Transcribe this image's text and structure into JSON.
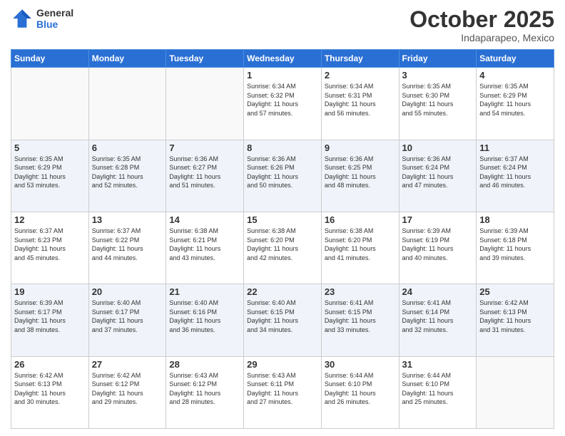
{
  "header": {
    "logo_general": "General",
    "logo_blue": "Blue",
    "month_title": "October 2025",
    "location": "Indaparapeo, Mexico"
  },
  "weekdays": [
    "Sunday",
    "Monday",
    "Tuesday",
    "Wednesday",
    "Thursday",
    "Friday",
    "Saturday"
  ],
  "weeks": [
    [
      {
        "day": "",
        "info": ""
      },
      {
        "day": "",
        "info": ""
      },
      {
        "day": "",
        "info": ""
      },
      {
        "day": "1",
        "info": "Sunrise: 6:34 AM\nSunset: 6:32 PM\nDaylight: 11 hours\nand 57 minutes."
      },
      {
        "day": "2",
        "info": "Sunrise: 6:34 AM\nSunset: 6:31 PM\nDaylight: 11 hours\nand 56 minutes."
      },
      {
        "day": "3",
        "info": "Sunrise: 6:35 AM\nSunset: 6:30 PM\nDaylight: 11 hours\nand 55 minutes."
      },
      {
        "day": "4",
        "info": "Sunrise: 6:35 AM\nSunset: 6:29 PM\nDaylight: 11 hours\nand 54 minutes."
      }
    ],
    [
      {
        "day": "5",
        "info": "Sunrise: 6:35 AM\nSunset: 6:29 PM\nDaylight: 11 hours\nand 53 minutes."
      },
      {
        "day": "6",
        "info": "Sunrise: 6:35 AM\nSunset: 6:28 PM\nDaylight: 11 hours\nand 52 minutes."
      },
      {
        "day": "7",
        "info": "Sunrise: 6:36 AM\nSunset: 6:27 PM\nDaylight: 11 hours\nand 51 minutes."
      },
      {
        "day": "8",
        "info": "Sunrise: 6:36 AM\nSunset: 6:26 PM\nDaylight: 11 hours\nand 50 minutes."
      },
      {
        "day": "9",
        "info": "Sunrise: 6:36 AM\nSunset: 6:25 PM\nDaylight: 11 hours\nand 48 minutes."
      },
      {
        "day": "10",
        "info": "Sunrise: 6:36 AM\nSunset: 6:24 PM\nDaylight: 11 hours\nand 47 minutes."
      },
      {
        "day": "11",
        "info": "Sunrise: 6:37 AM\nSunset: 6:24 PM\nDaylight: 11 hours\nand 46 minutes."
      }
    ],
    [
      {
        "day": "12",
        "info": "Sunrise: 6:37 AM\nSunset: 6:23 PM\nDaylight: 11 hours\nand 45 minutes."
      },
      {
        "day": "13",
        "info": "Sunrise: 6:37 AM\nSunset: 6:22 PM\nDaylight: 11 hours\nand 44 minutes."
      },
      {
        "day": "14",
        "info": "Sunrise: 6:38 AM\nSunset: 6:21 PM\nDaylight: 11 hours\nand 43 minutes."
      },
      {
        "day": "15",
        "info": "Sunrise: 6:38 AM\nSunset: 6:20 PM\nDaylight: 11 hours\nand 42 minutes."
      },
      {
        "day": "16",
        "info": "Sunrise: 6:38 AM\nSunset: 6:20 PM\nDaylight: 11 hours\nand 41 minutes."
      },
      {
        "day": "17",
        "info": "Sunrise: 6:39 AM\nSunset: 6:19 PM\nDaylight: 11 hours\nand 40 minutes."
      },
      {
        "day": "18",
        "info": "Sunrise: 6:39 AM\nSunset: 6:18 PM\nDaylight: 11 hours\nand 39 minutes."
      }
    ],
    [
      {
        "day": "19",
        "info": "Sunrise: 6:39 AM\nSunset: 6:17 PM\nDaylight: 11 hours\nand 38 minutes."
      },
      {
        "day": "20",
        "info": "Sunrise: 6:40 AM\nSunset: 6:17 PM\nDaylight: 11 hours\nand 37 minutes."
      },
      {
        "day": "21",
        "info": "Sunrise: 6:40 AM\nSunset: 6:16 PM\nDaylight: 11 hours\nand 36 minutes."
      },
      {
        "day": "22",
        "info": "Sunrise: 6:40 AM\nSunset: 6:15 PM\nDaylight: 11 hours\nand 34 minutes."
      },
      {
        "day": "23",
        "info": "Sunrise: 6:41 AM\nSunset: 6:15 PM\nDaylight: 11 hours\nand 33 minutes."
      },
      {
        "day": "24",
        "info": "Sunrise: 6:41 AM\nSunset: 6:14 PM\nDaylight: 11 hours\nand 32 minutes."
      },
      {
        "day": "25",
        "info": "Sunrise: 6:42 AM\nSunset: 6:13 PM\nDaylight: 11 hours\nand 31 minutes."
      }
    ],
    [
      {
        "day": "26",
        "info": "Sunrise: 6:42 AM\nSunset: 6:13 PM\nDaylight: 11 hours\nand 30 minutes."
      },
      {
        "day": "27",
        "info": "Sunrise: 6:42 AM\nSunset: 6:12 PM\nDaylight: 11 hours\nand 29 minutes."
      },
      {
        "day": "28",
        "info": "Sunrise: 6:43 AM\nSunset: 6:12 PM\nDaylight: 11 hours\nand 28 minutes."
      },
      {
        "day": "29",
        "info": "Sunrise: 6:43 AM\nSunset: 6:11 PM\nDaylight: 11 hours\nand 27 minutes."
      },
      {
        "day": "30",
        "info": "Sunrise: 6:44 AM\nSunset: 6:10 PM\nDaylight: 11 hours\nand 26 minutes."
      },
      {
        "day": "31",
        "info": "Sunrise: 6:44 AM\nSunset: 6:10 PM\nDaylight: 11 hours\nand 25 minutes."
      },
      {
        "day": "",
        "info": ""
      }
    ]
  ]
}
